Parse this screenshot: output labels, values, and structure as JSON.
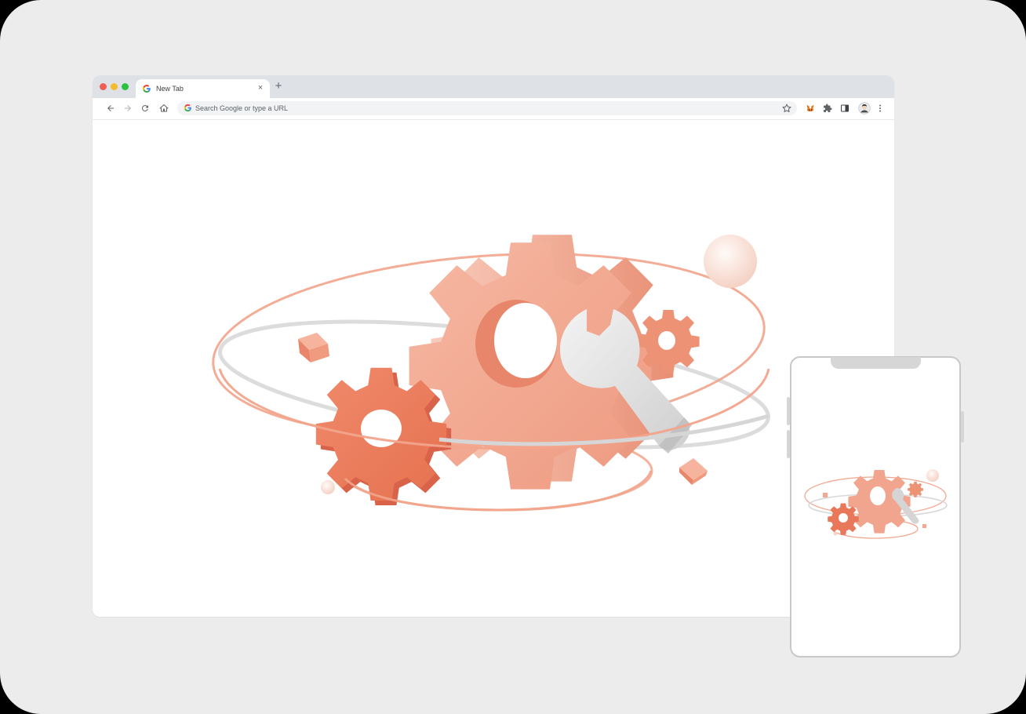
{
  "browser": {
    "tab": {
      "title": "New Tab",
      "close_symbol": "×"
    },
    "new_tab_symbol": "+",
    "omnibox": {
      "placeholder": "Search Google or type a URL"
    }
  },
  "icons": {
    "back": "arrow-left-icon",
    "forward": "arrow-right-icon",
    "reload": "reload-icon",
    "home": "home-icon",
    "bookmark": "star-icon",
    "extension_fox": "metamask-fox-icon",
    "extensions": "puzzle-icon",
    "side_panel": "side-panel-icon",
    "profile": "avatar-icon",
    "menu": "kebab-menu-icon"
  },
  "colors": {
    "accent_coral": "#f0a48c",
    "deep_coral": "#ec7b5c",
    "ring_gray": "#d9d9d9",
    "tabstrip": "#dee1e6",
    "frame_bg": "#ececec"
  }
}
